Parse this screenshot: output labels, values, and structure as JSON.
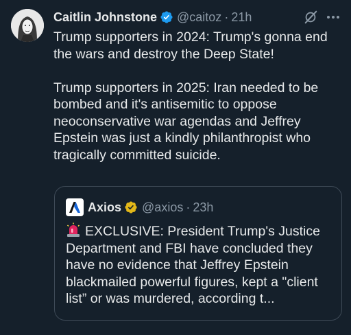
{
  "tweet": {
    "author_name": "Caitlin Johnstone",
    "handle": "@caitoz",
    "separator": "·",
    "time": "21h",
    "paragraphs": [
      "Trump supporters in 2024: Trump's gonna end the wars and destroy the Deep State!",
      "Trump supporters in 2025: Iran needed to be bombed and it's antisemitic to oppose neoconservative war agendas and Jeffrey Epstein was just a kindly philanthropist who tragically committed suicide."
    ]
  },
  "quote": {
    "author_name": "Axios",
    "handle": "@axios",
    "separator": "·",
    "time": "23h",
    "text": "EXCLUSIVE: President Trump's Justice Department and FBI have concluded they have no evidence that Jeffrey Epstein blackmailed powerful figures, kept a \"client list” or was murdered, according t..."
  },
  "icons": {
    "verified": "verified-badge-icon",
    "grok": "grok-icon",
    "more": "more-icon",
    "gold_verified": "gold-verified-badge-icon",
    "siren": "rotating-light-emoji"
  },
  "colors": {
    "background": "#15202b",
    "text": "#e7e9ea",
    "secondary": "#8b98a5",
    "verified_blue": "#1d9bf0",
    "gold": "#e2b719",
    "border": "#3e4a57"
  }
}
